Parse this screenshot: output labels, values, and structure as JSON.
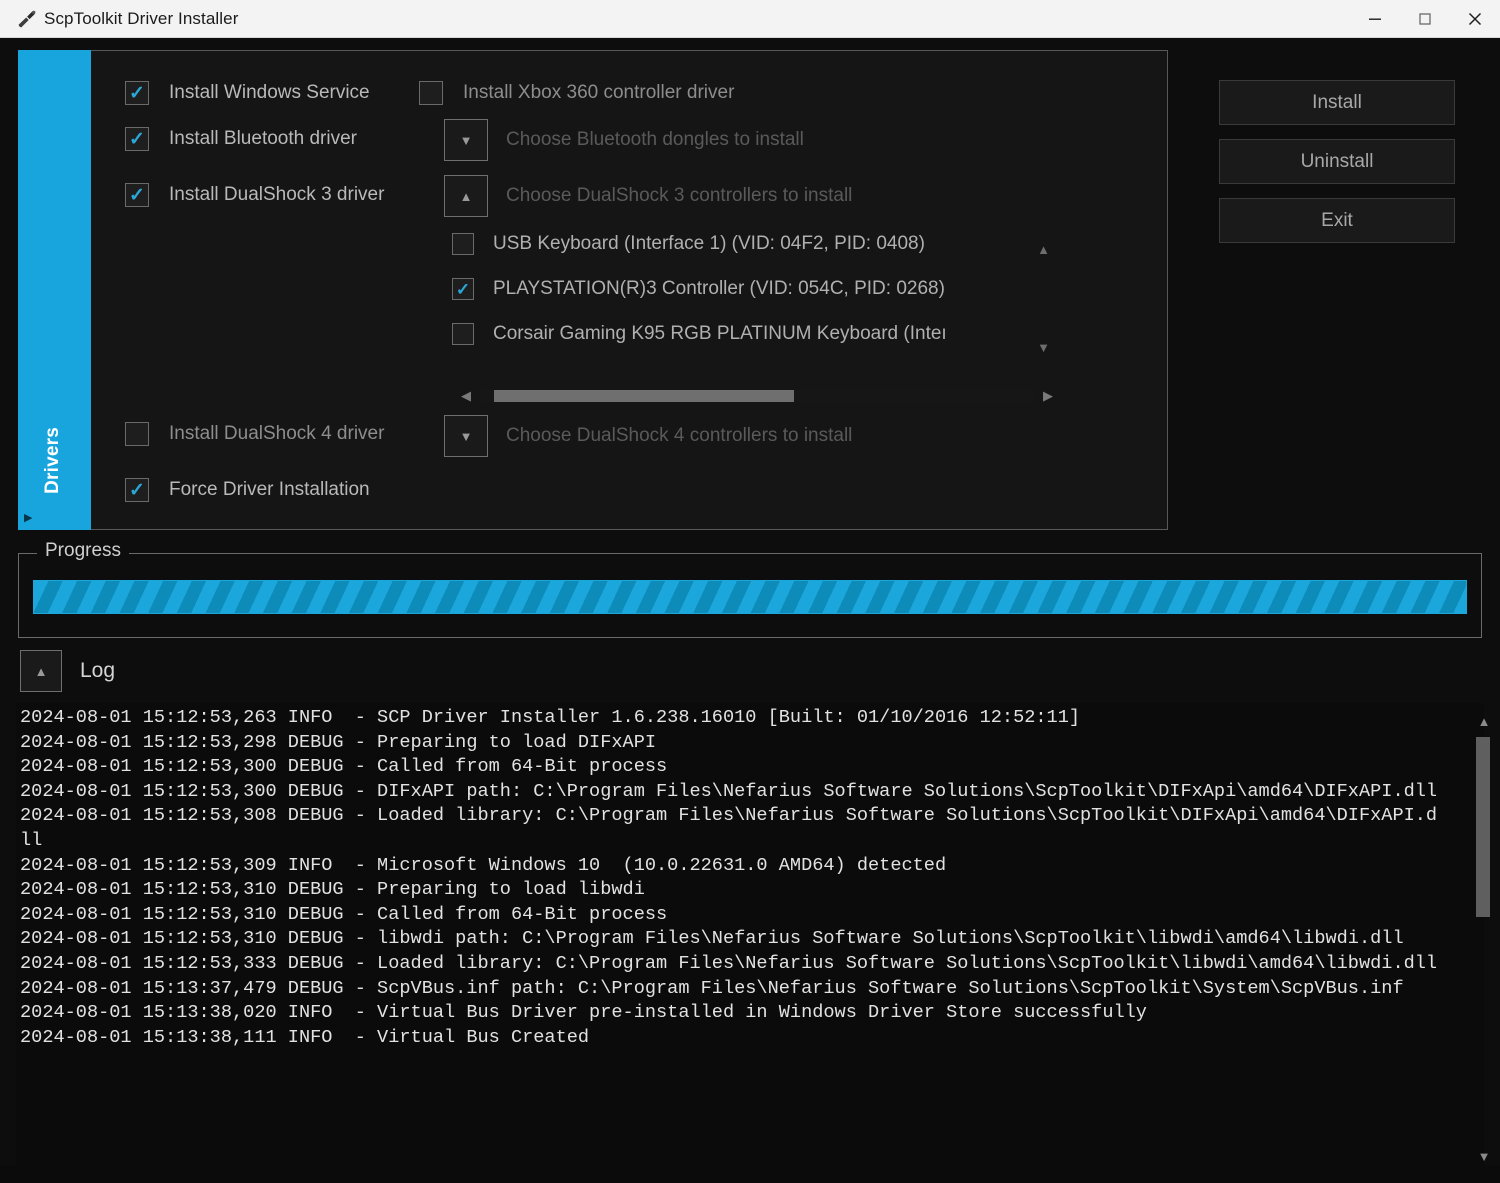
{
  "window": {
    "title": "ScpToolkit Driver Installer",
    "icon": "screwdriver-icon",
    "controls": {
      "minimize": "–",
      "maximize": "☐",
      "close": "✕"
    }
  },
  "tab": {
    "label": "Drivers",
    "expander": "▶",
    "accent_color": "#18a5dd"
  },
  "options": {
    "install_windows_service": {
      "label": "Install Windows Service",
      "checked": true
    },
    "install_xbox360_driver": {
      "label": "Install Xbox 360 controller driver",
      "checked": false
    },
    "install_bluetooth_driver": {
      "label": "Install Bluetooth driver",
      "checked": true
    },
    "install_ds3_driver": {
      "label": "Install DualShock 3 driver",
      "checked": true
    },
    "install_ds4_driver": {
      "label": "Install DualShock 4 driver",
      "checked": false
    },
    "force_driver_installation": {
      "label": "Force Driver Installation",
      "checked": true
    }
  },
  "dropdowns": {
    "bluetooth": {
      "label": "Choose Bluetooth dongles to install",
      "arrow": "▼",
      "expanded": false
    },
    "ds3": {
      "label": "Choose DualShock 3 controllers to install",
      "arrow": "▲",
      "expanded": true
    },
    "ds4": {
      "label": "Choose DualShock 4 controllers to install",
      "arrow": "▼",
      "expanded": false
    }
  },
  "device_list": {
    "items": [
      {
        "label": "USB Keyboard (Interface 1) (VID: 04F2, PID: 0408)",
        "checked": false
      },
      {
        "label": "PLAYSTATION(R)3 Controller (VID: 054C, PID: 0268)",
        "checked": true
      },
      {
        "label": "Corsair Gaming K95 RGB PLATINUM Keyboard (Inteı",
        "checked": false
      }
    ],
    "scroll_up": "▲",
    "scroll_down": "▼",
    "hscroll_left": "◀",
    "hscroll_right": "▶"
  },
  "actions": {
    "install": "Install",
    "uninstall": "Uninstall",
    "exit": "Exit"
  },
  "progress": {
    "legend": "Progress",
    "indeterminate": true,
    "percent": 100,
    "color": "#1ca7dc"
  },
  "log": {
    "title": "Log",
    "toggle_arrow": "▲",
    "scroll_up": "▲",
    "scroll_down": "▼",
    "lines": "2024-08-01 15:12:53,263 INFO  - SCP Driver Installer 1.6.238.16010 [Built: 01/10/2016 12:52:11]\n2024-08-01 15:12:53,298 DEBUG - Preparing to load DIFxAPI\n2024-08-01 15:12:53,300 DEBUG - Called from 64-Bit process\n2024-08-01 15:12:53,300 DEBUG - DIFxAPI path: C:\\Program Files\\Nefarius Software Solutions\\ScpToolkit\\DIFxApi\\amd64\\DIFxAPI.dll\n2024-08-01 15:12:53,308 DEBUG - Loaded library: C:\\Program Files\\Nefarius Software Solutions\\ScpToolkit\\DIFxApi\\amd64\\DIFxAPI.dll\n2024-08-01 15:12:53,309 INFO  - Microsoft Windows 10  (10.0.22631.0 AMD64) detected\n2024-08-01 15:12:53,310 DEBUG - Preparing to load libwdi\n2024-08-01 15:12:53,310 DEBUG - Called from 64-Bit process\n2024-08-01 15:12:53,310 DEBUG - libwdi path: C:\\Program Files\\Nefarius Software Solutions\\ScpToolkit\\libwdi\\amd64\\libwdi.dll\n2024-08-01 15:12:53,333 DEBUG - Loaded library: C:\\Program Files\\Nefarius Software Solutions\\ScpToolkit\\libwdi\\amd64\\libwdi.dll\n2024-08-01 15:13:37,479 DEBUG - ScpVBus.inf path: C:\\Program Files\\Nefarius Software Solutions\\ScpToolkit\\System\\ScpVBus.inf\n2024-08-01 15:13:38,020 INFO  - Virtual Bus Driver pre-installed in Windows Driver Store successfully\n2024-08-01 15:13:38,111 INFO  - Virtual Bus Created"
  }
}
